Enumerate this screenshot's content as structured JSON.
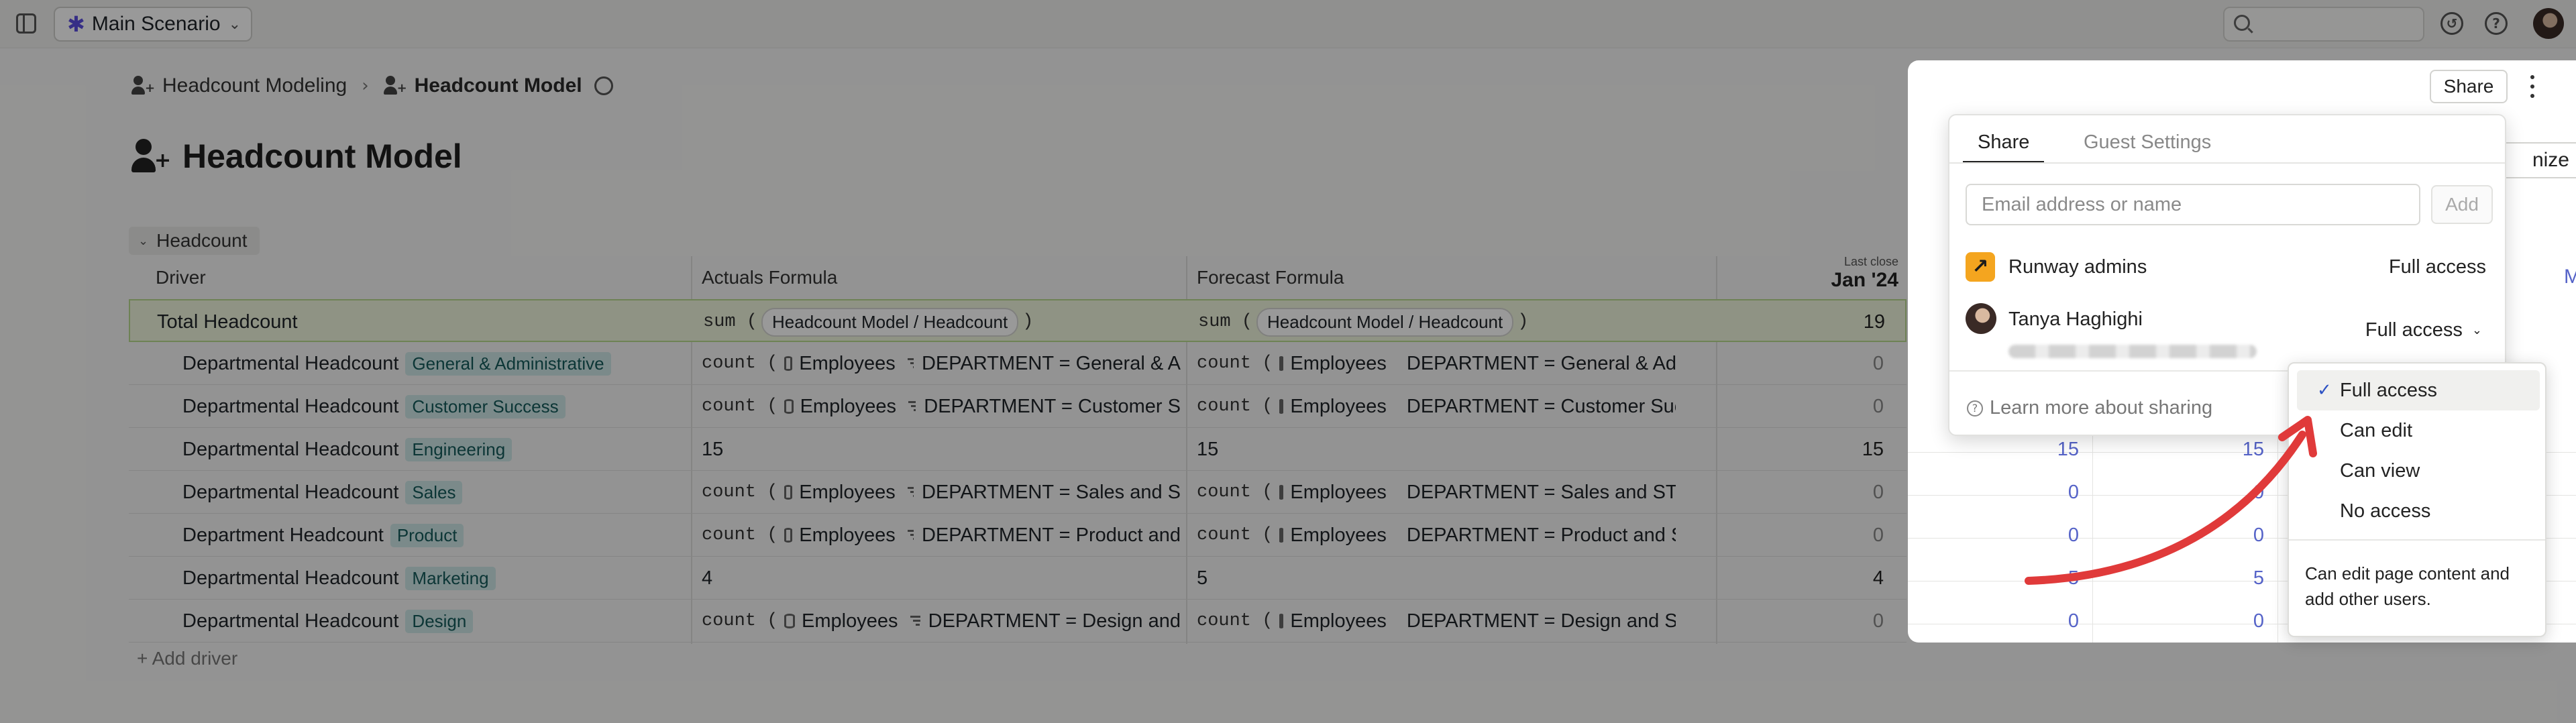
{
  "topbar": {
    "scenario": "Main Scenario",
    "search_placeholder": ""
  },
  "breadcrumb": {
    "parent": "Headcount Modeling",
    "current": "Headcount Model"
  },
  "page": {
    "title": "Headcount Model"
  },
  "table": {
    "group": "Headcount",
    "columns": {
      "driver": "Driver",
      "actuals": "Actuals Formula",
      "forecast": "Forecast Formula",
      "last_close_label": "Last close",
      "last_close_month": "Jan '24"
    },
    "total": {
      "name": "Total Headcount",
      "act_fn": "sum (",
      "act_ref": "Headcount Model / Headcount",
      "fct_fn": "sum (",
      "fct_ref": "Headcount Model / Headcount",
      "close": ")",
      "value": "19"
    },
    "rows": [
      {
        "name": "Departmental Headcount",
        "dept": "General & Administrative",
        "act_fn": "count (",
        "act_db": "Employees",
        "act_filter": "DEPARTMENT = General & A",
        "fct_fn": "count (",
        "fct_db": "Employees",
        "fct_filter": "DEPARTMENT = General & Admi",
        "value": "0"
      },
      {
        "name": "Departmental Headcount",
        "dept": "Customer Success",
        "act_fn": "count (",
        "act_db": "Employees",
        "act_filter": "DEPARTMENT = Customer S",
        "fct_fn": "count (",
        "fct_db": "Employees",
        "fct_filter": "DEPARTMENT = Customer Succ",
        "value": "0"
      },
      {
        "name": "Departmental Headcount",
        "dept": "Engineering",
        "act_text": "15",
        "fct_text": "15",
        "value": "15"
      },
      {
        "name": "Departmental Headcount",
        "dept": "Sales",
        "act_fn": "count (",
        "act_db": "Employees",
        "act_filter": "DEPARTMENT = Sales and S",
        "fct_fn": "count (",
        "fct_db": "Employees",
        "fct_filter": "DEPARTMENT = Sales and STAR",
        "value": "0"
      },
      {
        "name": "Department Headcount",
        "dept": "Product",
        "act_fn": "count (",
        "act_db": "Employees",
        "act_filter": "DEPARTMENT = Product and",
        "fct_fn": "count (",
        "fct_db": "Employees",
        "fct_filter": "DEPARTMENT = Product and ST",
        "value": "0"
      },
      {
        "name": "Departmental Headcount",
        "dept": "Marketing",
        "act_text": "4",
        "fct_text": "5",
        "value": "4"
      },
      {
        "name": "Departmental Headcount",
        "dept": "Design",
        "act_fn": "count (",
        "act_db": "Employees",
        "act_filter": "DEPARTMENT = Design and",
        "fct_fn": "count (",
        "fct_db": "Employees",
        "fct_filter": "DEPARTMENT = Design and STA",
        "value": "0"
      }
    ],
    "add_driver": "Add driver"
  },
  "panel": {
    "share_button": "Share",
    "customize_partial": "nize",
    "edge_letter": "M",
    "col1": [
      "15",
      "0",
      "0",
      "5",
      "0"
    ],
    "col2": [
      "15",
      "0",
      "0",
      "5",
      "0"
    ]
  },
  "share_popover": {
    "tabs": [
      "Share",
      "Guest Settings"
    ],
    "email_placeholder": "Email address or name",
    "add_label": "Add",
    "members": [
      {
        "name": "Runway admins",
        "access": "Full access"
      },
      {
        "name": "Tanya Haghighi",
        "access": "Full access"
      }
    ],
    "learn_more": "Learn more about sharing"
  },
  "access_menu": {
    "options": [
      "Full access",
      "Can edit",
      "Can view",
      "No access"
    ],
    "selected": "Full access",
    "description": "Can edit page content and add other users."
  },
  "colors": {
    "accent": "#5563c8",
    "total_row": "#eef6dc",
    "dept_chip": "#cde6e6",
    "annotation_arrow": "#e03a3a"
  }
}
